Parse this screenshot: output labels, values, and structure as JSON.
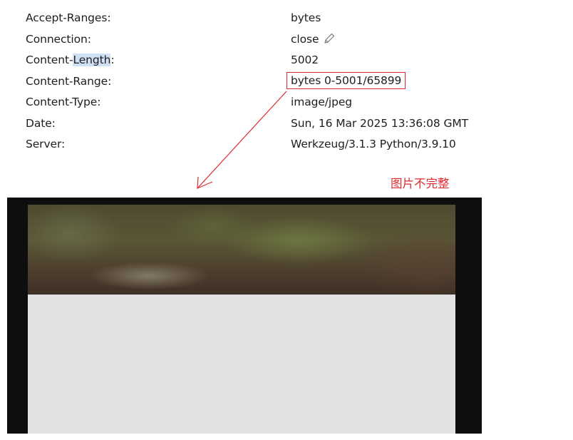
{
  "response_headers": [
    {
      "name_parts": [
        "Accept-Ranges:"
      ],
      "value": "bytes"
    },
    {
      "name_parts": [
        "Connection:"
      ],
      "value": "close"
    },
    {
      "name_parts": [
        "Content-",
        "Length",
        ":"
      ],
      "value": "5002"
    },
    {
      "name_parts": [
        "Content-Range:"
      ],
      "value": "bytes 0-5001/65899"
    },
    {
      "name_parts": [
        "Content-Type:"
      ],
      "value": "image/jpeg"
    },
    {
      "name_parts": [
        "Date:"
      ],
      "value": "Sun, 16 Mar 2025 13:36:08 GMT"
    },
    {
      "name_parts": [
        "Server:"
      ],
      "value": "Werkzeug/3.1.3 Python/3.9.10"
    }
  ],
  "icons": {
    "connection_edit": "pencil-icon"
  },
  "annotation": {
    "label": "图片不完整",
    "color": "#e0282e"
  },
  "colors": {
    "selection_highlight": "#cfe0f5",
    "viewer_background": "#0e0e0e",
    "missing_image_area": "#e2e2e2"
  }
}
